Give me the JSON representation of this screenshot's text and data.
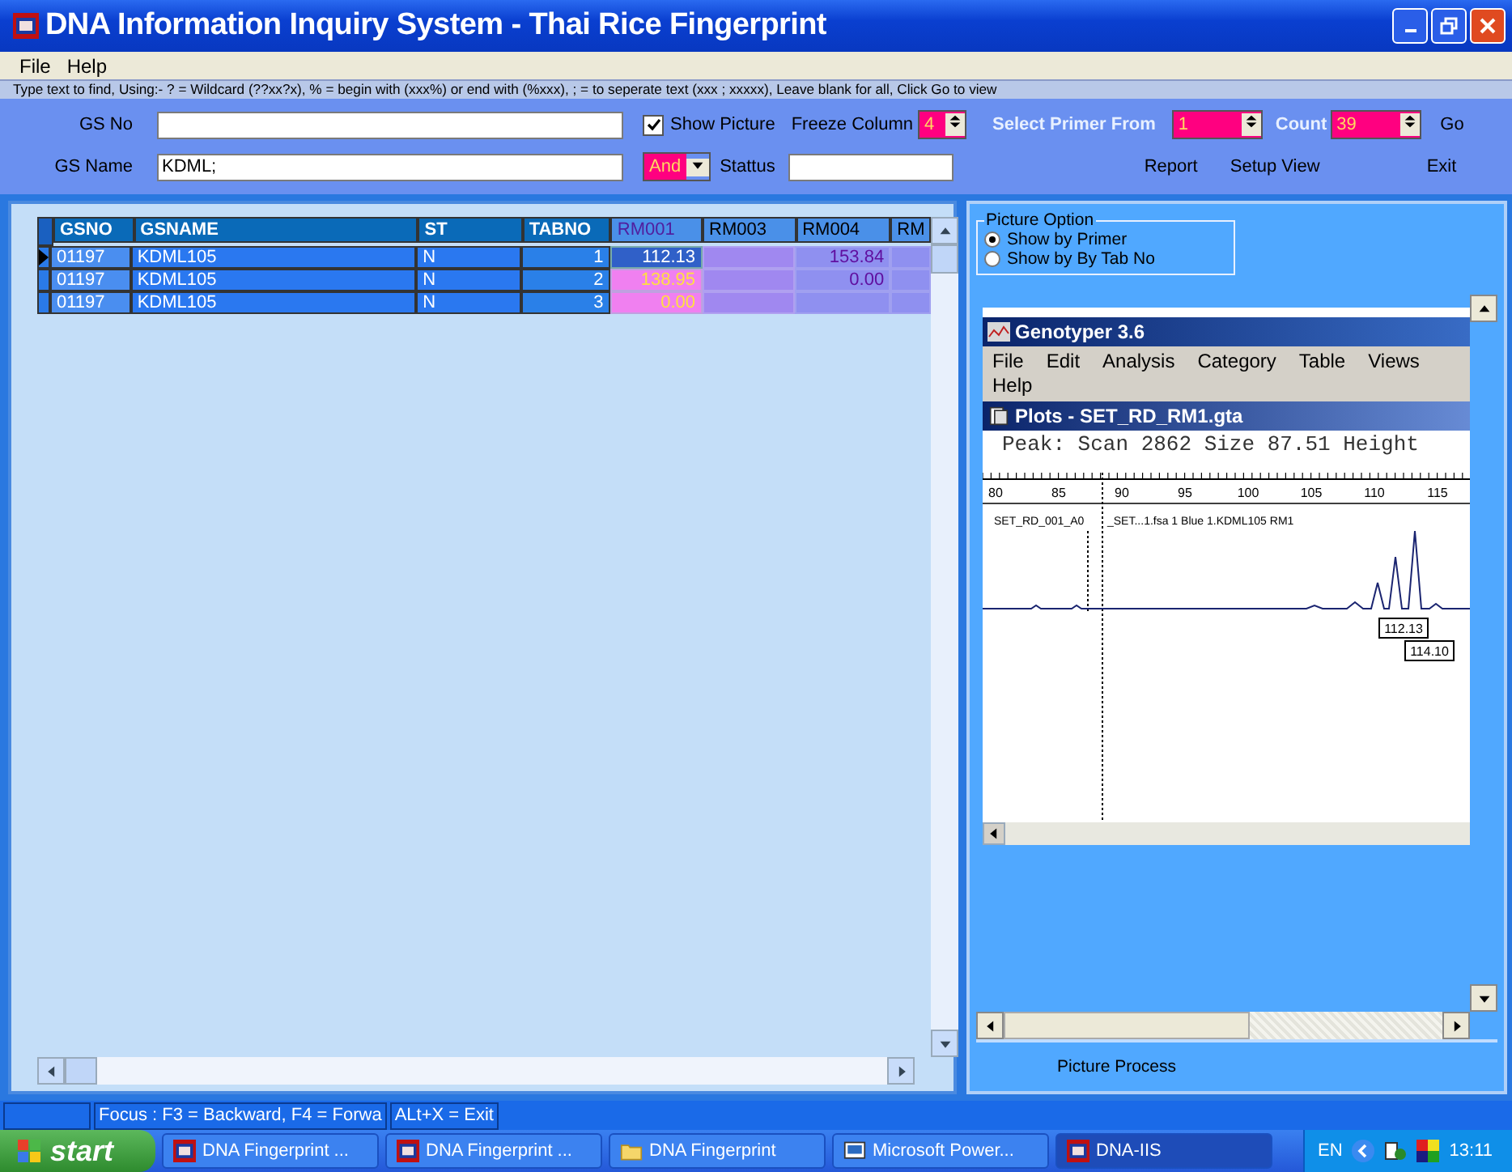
{
  "window": {
    "title": "DNA Information Inquiry System - Thai Rice Fingerprint"
  },
  "menu": [
    "File",
    "Help"
  ],
  "hint": "Type text to find, Using:- ? = Wildcard (??xx?x), % = begin with (xxx%) or end  with (%xxx), ; = to seperate text (xxx ; xxxxx), Leave blank for all, Click Go to view",
  "form": {
    "gs_no": {
      "label": "GS No"
    },
    "gs_name": {
      "label": "GS Name",
      "value": "KDML;"
    },
    "show_picture": {
      "label": "Show Picture",
      "checked": true
    },
    "freeze_column": {
      "label": "Freeze Column",
      "value": "4"
    },
    "operator": {
      "value": "And"
    },
    "status": {
      "label": "Stattus"
    },
    "primer_from": {
      "label": "Select Primer From",
      "value": "1"
    },
    "count": {
      "label": "Count",
      "value": "39"
    },
    "buttons": [
      "Go",
      "Report",
      "Setup View",
      "Exit"
    ]
  },
  "table": {
    "columns": [
      "GSNO",
      "GSNAME",
      "ST",
      "TABNO",
      "RM001",
      "RM003",
      "RM004",
      "RM"
    ],
    "rows": [
      {
        "selected": true,
        "cells": [
          "01197",
          "KDML105",
          "N",
          "1",
          "112.13",
          "",
          "153.84",
          ""
        ]
      },
      {
        "selected": false,
        "cells": [
          "01197",
          "KDML105",
          "N",
          "2",
          "138.95",
          "",
          "0.00",
          ""
        ]
      },
      {
        "selected": false,
        "cells": [
          "01197",
          "KDML105",
          "N",
          "3",
          "0.00",
          "",
          "",
          ""
        ]
      }
    ]
  },
  "picture_option": {
    "title": "Picture Option",
    "options": [
      {
        "label": "Show by Primer",
        "selected": true
      },
      {
        "label": "Show by By Tab No",
        "selected": false
      }
    ]
  },
  "genotyper": {
    "title": "Genotyper 3.6",
    "menu": [
      "File",
      "Edit",
      "Analysis",
      "Category",
      "Table",
      "Views",
      "Help"
    ],
    "plot_title": "Plots - SET_RD_RM1.gta",
    "peak_info": "Peak: Scan 2862  Size 87.51  Height",
    "scale": [
      "80",
      "85",
      "90",
      "95",
      "100",
      "105",
      "110",
      "115"
    ],
    "sample": "SET_RD_001_A0",
    "trace_label": "_SET...1.fsa  1 Blue   1.KDML105 RM1",
    "peaks": [
      "112.13",
      "114.10"
    ]
  },
  "picture_process": "Picture Process",
  "status_bar": [
    "Focus : F3 = Backward,  F4 =  Forwa",
    "ALt+X = Exit"
  ],
  "taskbar": {
    "start": "start",
    "items": [
      {
        "label": "DNA Fingerprint ...",
        "kind": "app",
        "selected": false
      },
      {
        "label": "DNA Fingerprint ...",
        "kind": "app",
        "selected": false
      },
      {
        "label": "DNA Fingerprint",
        "kind": "folder",
        "selected": false
      },
      {
        "label": "Microsoft Power...",
        "kind": "slides",
        "selected": false
      },
      {
        "label": "DNA-IIS",
        "kind": "app",
        "selected": true
      }
    ],
    "lang": "EN",
    "clock": "13:11"
  }
}
